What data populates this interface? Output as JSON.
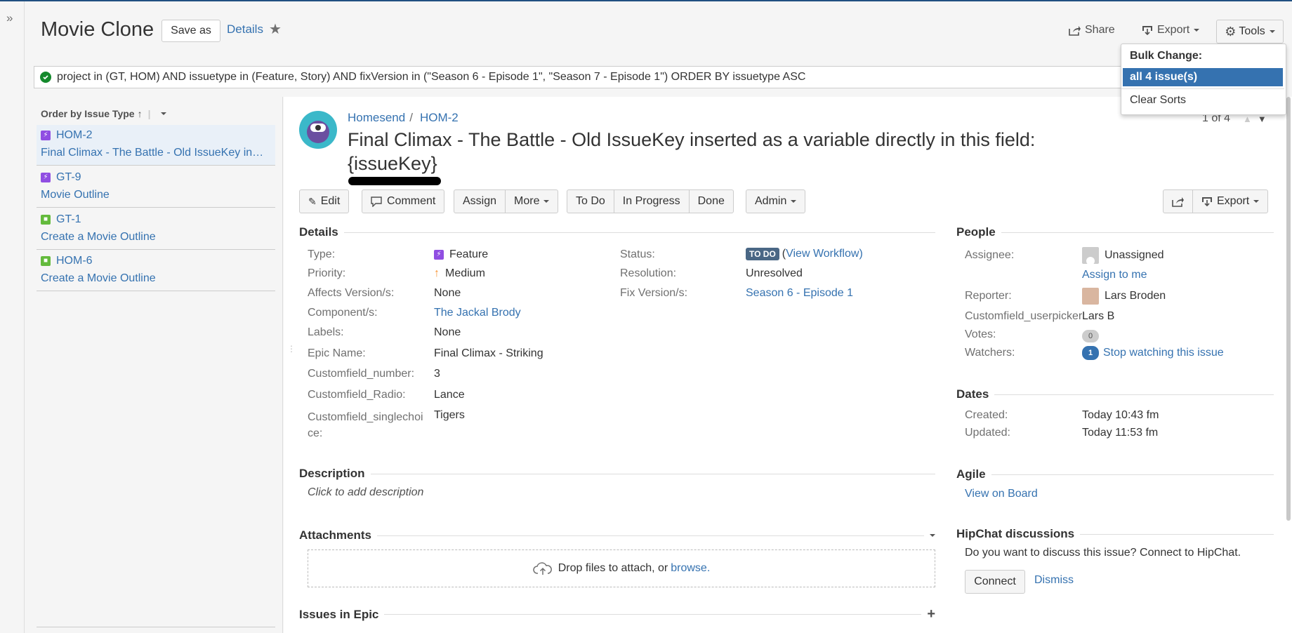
{
  "header": {
    "title": "Movie Clone",
    "save_as": "Save as",
    "details_link": "Details",
    "share": "Share",
    "export": "Export",
    "tools": "Tools"
  },
  "jql": {
    "query": "project in (GT, HOM) AND issuetype in (Feature, Story) AND fixVersion in (\"Season 6 - Episode 1\", \"Season 7 - Episode 1\") ORDER BY issuetype ASC"
  },
  "tools_menu": {
    "heading": "Bulk Change:",
    "all_issues": "all 4 issue(s)",
    "clear_sorts": "Clear Sorts"
  },
  "left": {
    "order_by": "Order by Issue Type",
    "items": [
      {
        "key": "HOM-2",
        "summary": "Final Climax - The Battle - Old IssueKey in…",
        "type": "feature-icon"
      },
      {
        "key": "GT-9",
        "summary": "Movie Outline",
        "type": "feature-icon"
      },
      {
        "key": "GT-1",
        "summary": "Create a Movie Outline",
        "type": "story-icon"
      },
      {
        "key": "HOM-6",
        "summary": "Create a Movie Outline",
        "type": "story-icon"
      }
    ]
  },
  "issue": {
    "project": "Homesend",
    "key": "HOM-2",
    "title_line1": "Final Climax - The Battle - Old IssueKey inserted as a variable directly in this field:",
    "title_line2": "{issueKey}",
    "pager": "1 of 4"
  },
  "toolbar": {
    "edit": "Edit",
    "comment": "Comment",
    "assign": "Assign",
    "more": "More",
    "todo": "To Do",
    "in_progress": "In Progress",
    "done": "Done",
    "admin": "Admin",
    "export": "Export"
  },
  "details": {
    "heading": "Details",
    "type_label": "Type:",
    "type_value": "Feature",
    "priority_label": "Priority:",
    "priority_value": "Medium",
    "affects_label": "Affects Version/s:",
    "affects_value": "None",
    "component_label": "Component/s:",
    "component_value": "The Jackal Brody",
    "labels_label": "Labels:",
    "labels_value": "None",
    "epic_label": "Epic Name:",
    "epic_value": "Final Climax - Striking",
    "number_label": "Customfield_number:",
    "number_value": "3",
    "radio_label": "Customfield_Radio:",
    "radio_value": "Lance",
    "single_label_1": "Customfield_singlechoi",
    "single_label_2": "ce:",
    "single_value": "Tigers",
    "status_label": "Status:",
    "status_value": "TO DO",
    "view_workflow": "View Workflow",
    "resolution_label": "Resolution:",
    "resolution_value": "Unresolved",
    "fix_label": "Fix Version/s:",
    "fix_value": "Season 6 - Episode 1"
  },
  "people": {
    "heading": "People",
    "assignee_label": "Assignee:",
    "assignee_value": "Unassigned",
    "assign_to_me": "Assign to me",
    "reporter_label": "Reporter:",
    "reporter_value": "Lars Broden",
    "userpicker_label": "Customfield_userpicker:",
    "userpicker_value": "Lars B",
    "votes_label": "Votes:",
    "votes_value": "0",
    "watchers_label": "Watchers:",
    "watchers_count": "1",
    "watchers_link": "Stop watching this issue"
  },
  "dates": {
    "heading": "Dates",
    "created_label": "Created:",
    "created_value": "Today 10:43 fm",
    "updated_label": "Updated:",
    "updated_value": "Today 11:53 fm"
  },
  "description": {
    "heading": "Description",
    "placeholder": "Click to add description"
  },
  "attachments": {
    "heading": "Attachments",
    "drop_text": "Drop files to attach, or ",
    "browse": "browse."
  },
  "agile": {
    "heading": "Agile",
    "view_on_board": "View on Board"
  },
  "hipchat": {
    "heading": "HipChat discussions",
    "text": "Do you want to discuss this issue? Connect to HipChat.",
    "connect": "Connect",
    "dismiss": "Dismiss"
  },
  "epic": {
    "heading": "Issues in Epic"
  },
  "colors": {
    "link": "#3572b0",
    "lozenge": "#4a6785",
    "feature": "#904ee2",
    "story": "#63ba3c",
    "selected": "#3572b0"
  }
}
